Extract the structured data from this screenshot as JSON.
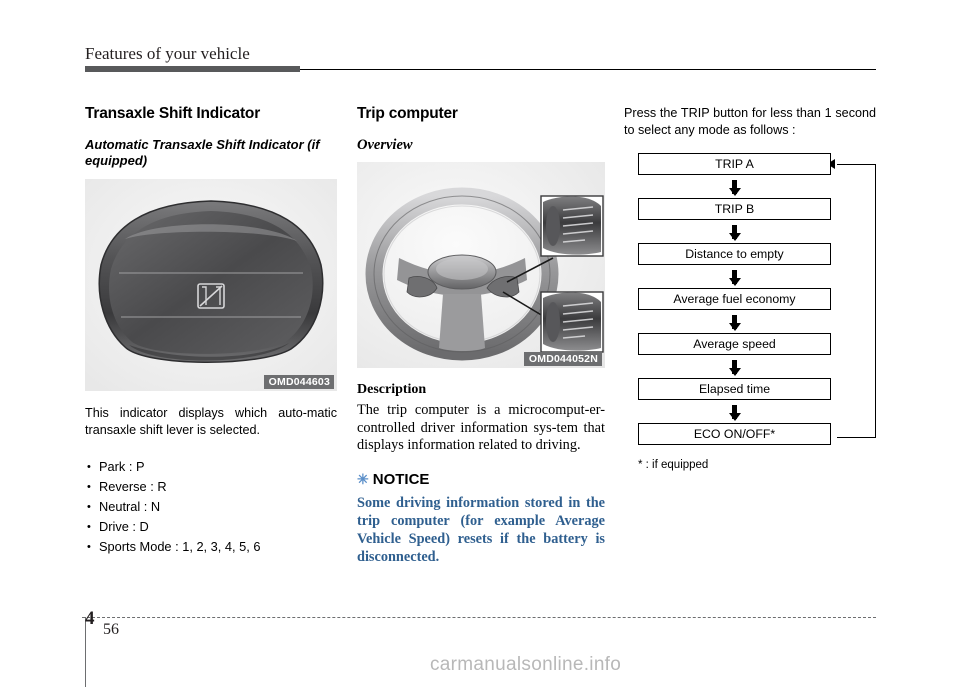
{
  "header": {
    "title": "Features of your vehicle"
  },
  "col1": {
    "heading": "Transaxle Shift Indicator",
    "subheading": "Automatic Transaxle Shift Indicator (if equipped)",
    "figure_code": "OMD044603",
    "figure_name": "automatic-transaxle-shift-indicator-photo",
    "paragraph": "This indicator displays which auto-matic transaxle shift lever is selected.",
    "bullets": [
      "Park : P",
      "Reverse : R",
      "Neutral : N",
      "Drive : D",
      "Sports Mode : 1, 2, 3, 4, 5, 6"
    ]
  },
  "col2": {
    "heading": "Trip computer",
    "subheading": "Overview",
    "figure_code": "OMD044052N",
    "figure_name": "steering-wheel-trip-button-photo",
    "description_heading": "Description",
    "description": "The trip computer is a microcomput-er-controlled driver information sys-tem that displays information related to driving.",
    "notice_label": "NOTICE",
    "notice_star": "✳",
    "notice_body": "Some driving information stored in the trip computer (for example Average Vehicle Speed) resets if the battery is disconnected."
  },
  "col3": {
    "intro": "Press the TRIP button for less than 1 second to select any mode as follows :",
    "flow_steps": [
      "TRIP A",
      "TRIP B",
      "Distance to empty",
      "Average fuel economy",
      "Average speed",
      "Elapsed time",
      "ECO ON/OFF*"
    ],
    "footnote": "* : if equipped"
  },
  "footer": {
    "chapter": "4",
    "page": "56",
    "watermark": "carmanualsonline.info"
  },
  "colors": {
    "rule_dark": "#58595b",
    "notice_text": "#2f5f8f",
    "notice_star": "#5b8fc9",
    "figure_bg": "#f1f1f1",
    "code_badge_bg": "#6d6e70"
  }
}
